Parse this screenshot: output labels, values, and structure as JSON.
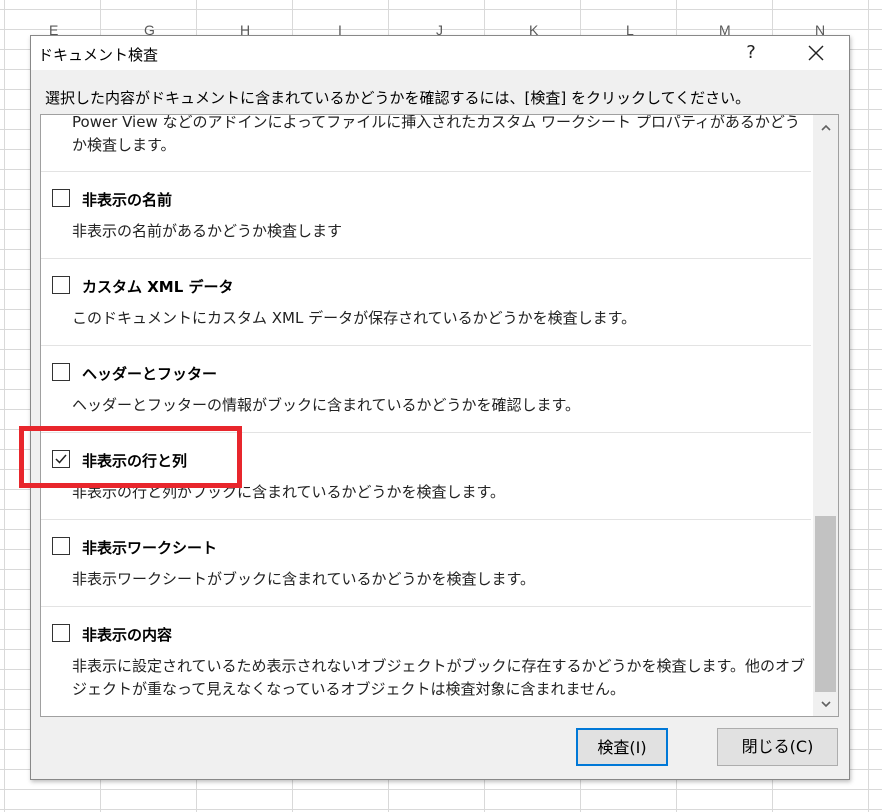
{
  "spreadsheet": {
    "column_letters": [
      "E",
      "G",
      "H",
      "I",
      "J",
      "K",
      "L",
      "M",
      "N"
    ]
  },
  "dialog": {
    "title": "ドキュメント検査",
    "help_label": "?",
    "instruction": "選択した内容がドキュメントに含まれているかどうかを確認するには、[検査] をクリックしてください。",
    "items": [
      {
        "title": "",
        "checked": false,
        "description": "Power View などのアドインによってファイルに挿入されたカスタム ワークシート プロパティがあるかどうか検査します。"
      },
      {
        "title": "非表示の名前",
        "checked": false,
        "description": "非表示の名前があるかどうか検査します"
      },
      {
        "title": "カスタム XML データ",
        "checked": false,
        "description": "このドキュメントにカスタム XML データが保存されているかどうかを検査します。"
      },
      {
        "title": "ヘッダーとフッター",
        "checked": false,
        "description": "ヘッダーとフッターの情報がブックに含まれているかどうかを確認します。"
      },
      {
        "title": "非表示の行と列",
        "checked": true,
        "description": "非表示の行と列がブックに含まれているかどうかを検査します。"
      },
      {
        "title": "非表示ワークシート",
        "checked": false,
        "description": "非表示ワークシートがブックに含まれているかどうかを検査します。"
      },
      {
        "title": "非表示の内容",
        "checked": false,
        "description": "非表示に設定されているため表示されないオブジェクトがブックに存在するかどうかを検査します。他のオブジェクトが重なって見えなくなっているオブジェクトは検査対象に含まれません。"
      }
    ],
    "buttons": {
      "inspect": "検査(I)",
      "close": "閉じる(C)"
    },
    "colors": {
      "highlight": "#e8262c",
      "default_button_border": "#0078d7"
    }
  }
}
